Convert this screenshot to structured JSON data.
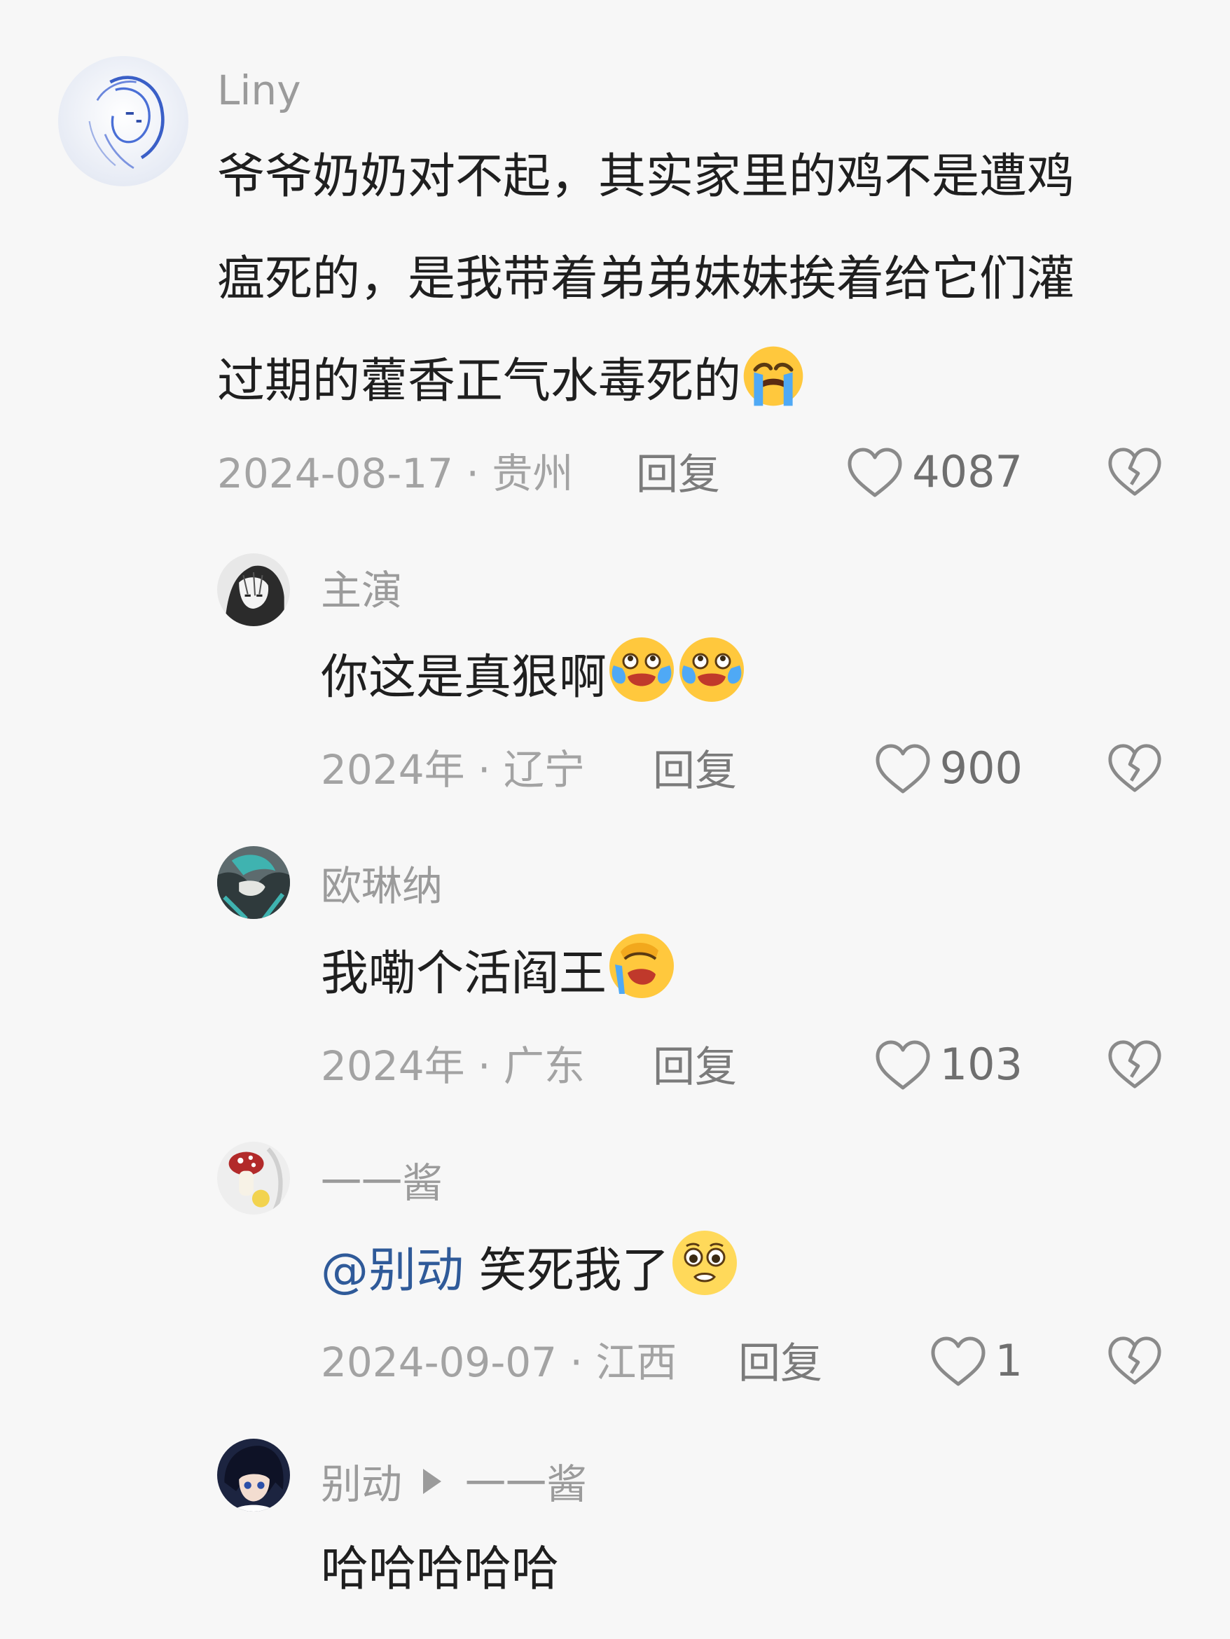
{
  "comments": [
    {
      "user": "Liny",
      "lines": [
        "爷爷奶奶对不起，其实家里的鸡不是遭鸡",
        "瘟死的，是我带着弟弟妹妹挨着给它们灌",
        "过期的藿香正气水毒死的"
      ],
      "emoji": "loudly-crying-emoji",
      "date": "2024-08-17",
      "location": "贵州",
      "reply_label": "回复",
      "likes": "4087"
    },
    {
      "user": "主演",
      "text": "你这是真狠啊",
      "emoji": "crying-laughing-emoji",
      "date": "2024年",
      "location": "辽宁",
      "reply_label": "回复",
      "likes": "900"
    },
    {
      "user": "欧琳纳",
      "text": "我嘞个活阎王",
      "emoji": "facepalm-crying-emoji",
      "date": "2024年",
      "location": "广东",
      "reply_label": "回复",
      "likes": "103"
    },
    {
      "user": "一一酱",
      "mention": "@别动",
      "text": "笑死我了",
      "emoji": "pleading-emoji",
      "date": "2024-09-07",
      "location": "江西",
      "reply_label": "回复",
      "likes": "1"
    },
    {
      "user": "别动",
      "reply_to": "一一酱",
      "text": "哈哈哈哈哈"
    }
  ],
  "separator": "·"
}
